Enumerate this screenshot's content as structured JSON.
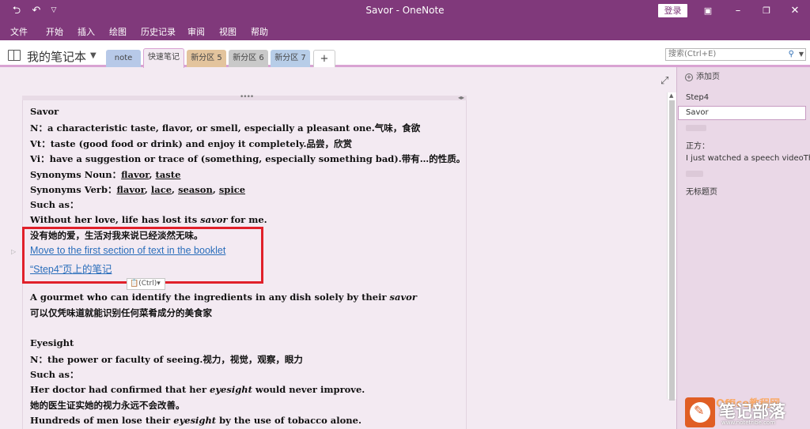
{
  "window": {
    "title": "Savor - OneNote",
    "signin_label": "登录",
    "colors": {
      "brand": "#80397b",
      "accent": "#d9a3d3",
      "link": "#2a6ebb",
      "highlight_box": "#e0202a"
    }
  },
  "titlebar_icons": [
    "back-icon",
    "undo-icon",
    "quick-access-dropdown-icon",
    "ribbon-display-icon",
    "minimize-icon",
    "restore-icon",
    "close-icon"
  ],
  "menu": [
    "文件",
    "开始",
    "插入",
    "绘图",
    "历史记录",
    "审阅",
    "视图",
    "帮助"
  ],
  "notebook": {
    "name": "我的笔记本"
  },
  "section_tabs": [
    {
      "label": "note",
      "color": "#b7c9e8"
    },
    {
      "label": "快速笔记",
      "color": "#f3eaf2"
    },
    {
      "label": "新分区 5",
      "color": "#e3c49d"
    },
    {
      "label": "新分区 6",
      "color": "#c9c9c9"
    },
    {
      "label": "新分区 7",
      "color": "#b7cde8"
    },
    {
      "label": "+",
      "color": "#ffffff"
    }
  ],
  "search": {
    "placeholder": "搜索(Ctrl+E)"
  },
  "content": {
    "l1": "Savor",
    "l2": "N：a characteristic taste, flavor, or smell, especially a pleasant one.气味，食欲",
    "l3": "Vt：taste (good food or drink) and enjoy it completely.品尝，欣赏",
    "l4": "Vi：have a suggestion or trace of (something, especially something bad).带有…的性质。",
    "l5_label": "Synonyms Noun：",
    "l5_a": "flavor",
    "l5_b": "taste",
    "l6_label": "Synonyms Verb：",
    "l6_a": "flavor",
    "l6_b": "lace",
    "l6_c": "season",
    "l6_d": "spice",
    "l7": "Such as：",
    "l8_a": " Without her love, life has lost its ",
    "l8_b": "savor",
    "l8_c": " for me.",
    "l9": "没有她的爱，生活对我来说已经淡然无味。",
    "link1": "Move to the first section of text in the booklet",
    "link2": "“Step4”页上的笔记",
    "paste_badge": "(Ctrl)",
    "l10_a": "A gourmet who can identify the ingredients in any dish solely by their ",
    "l10_b": "savor",
    "l11": "可以仅凭味道就能识别任何菜肴成分的美食家",
    "l12": "Eyesight",
    "l13": "N：the power or faculty of seeing.视力，视觉，观察，眼力",
    "l14": "Such as：",
    "l15_a": "Her doctor had confirmed that her ",
    "l15_b": "eyesight",
    "l15_c": " would never improve.",
    "l16": "她的医生证实她的视力永远不会改善。",
    "l17_a": "Hundreds of men lose their ",
    "l17_b": "eyesight",
    "l17_c": " by the use of tobacco alone."
  },
  "pages_panel": {
    "add_page": "添加页",
    "items": [
      "Step4",
      "Savor",
      "正方：",
      "I just watched a speech videoTh",
      "无标题页"
    ]
  },
  "watermark": {
    "title": "笔记部落",
    "office": "Office教程网",
    "url": "www.notetribe.com"
  }
}
